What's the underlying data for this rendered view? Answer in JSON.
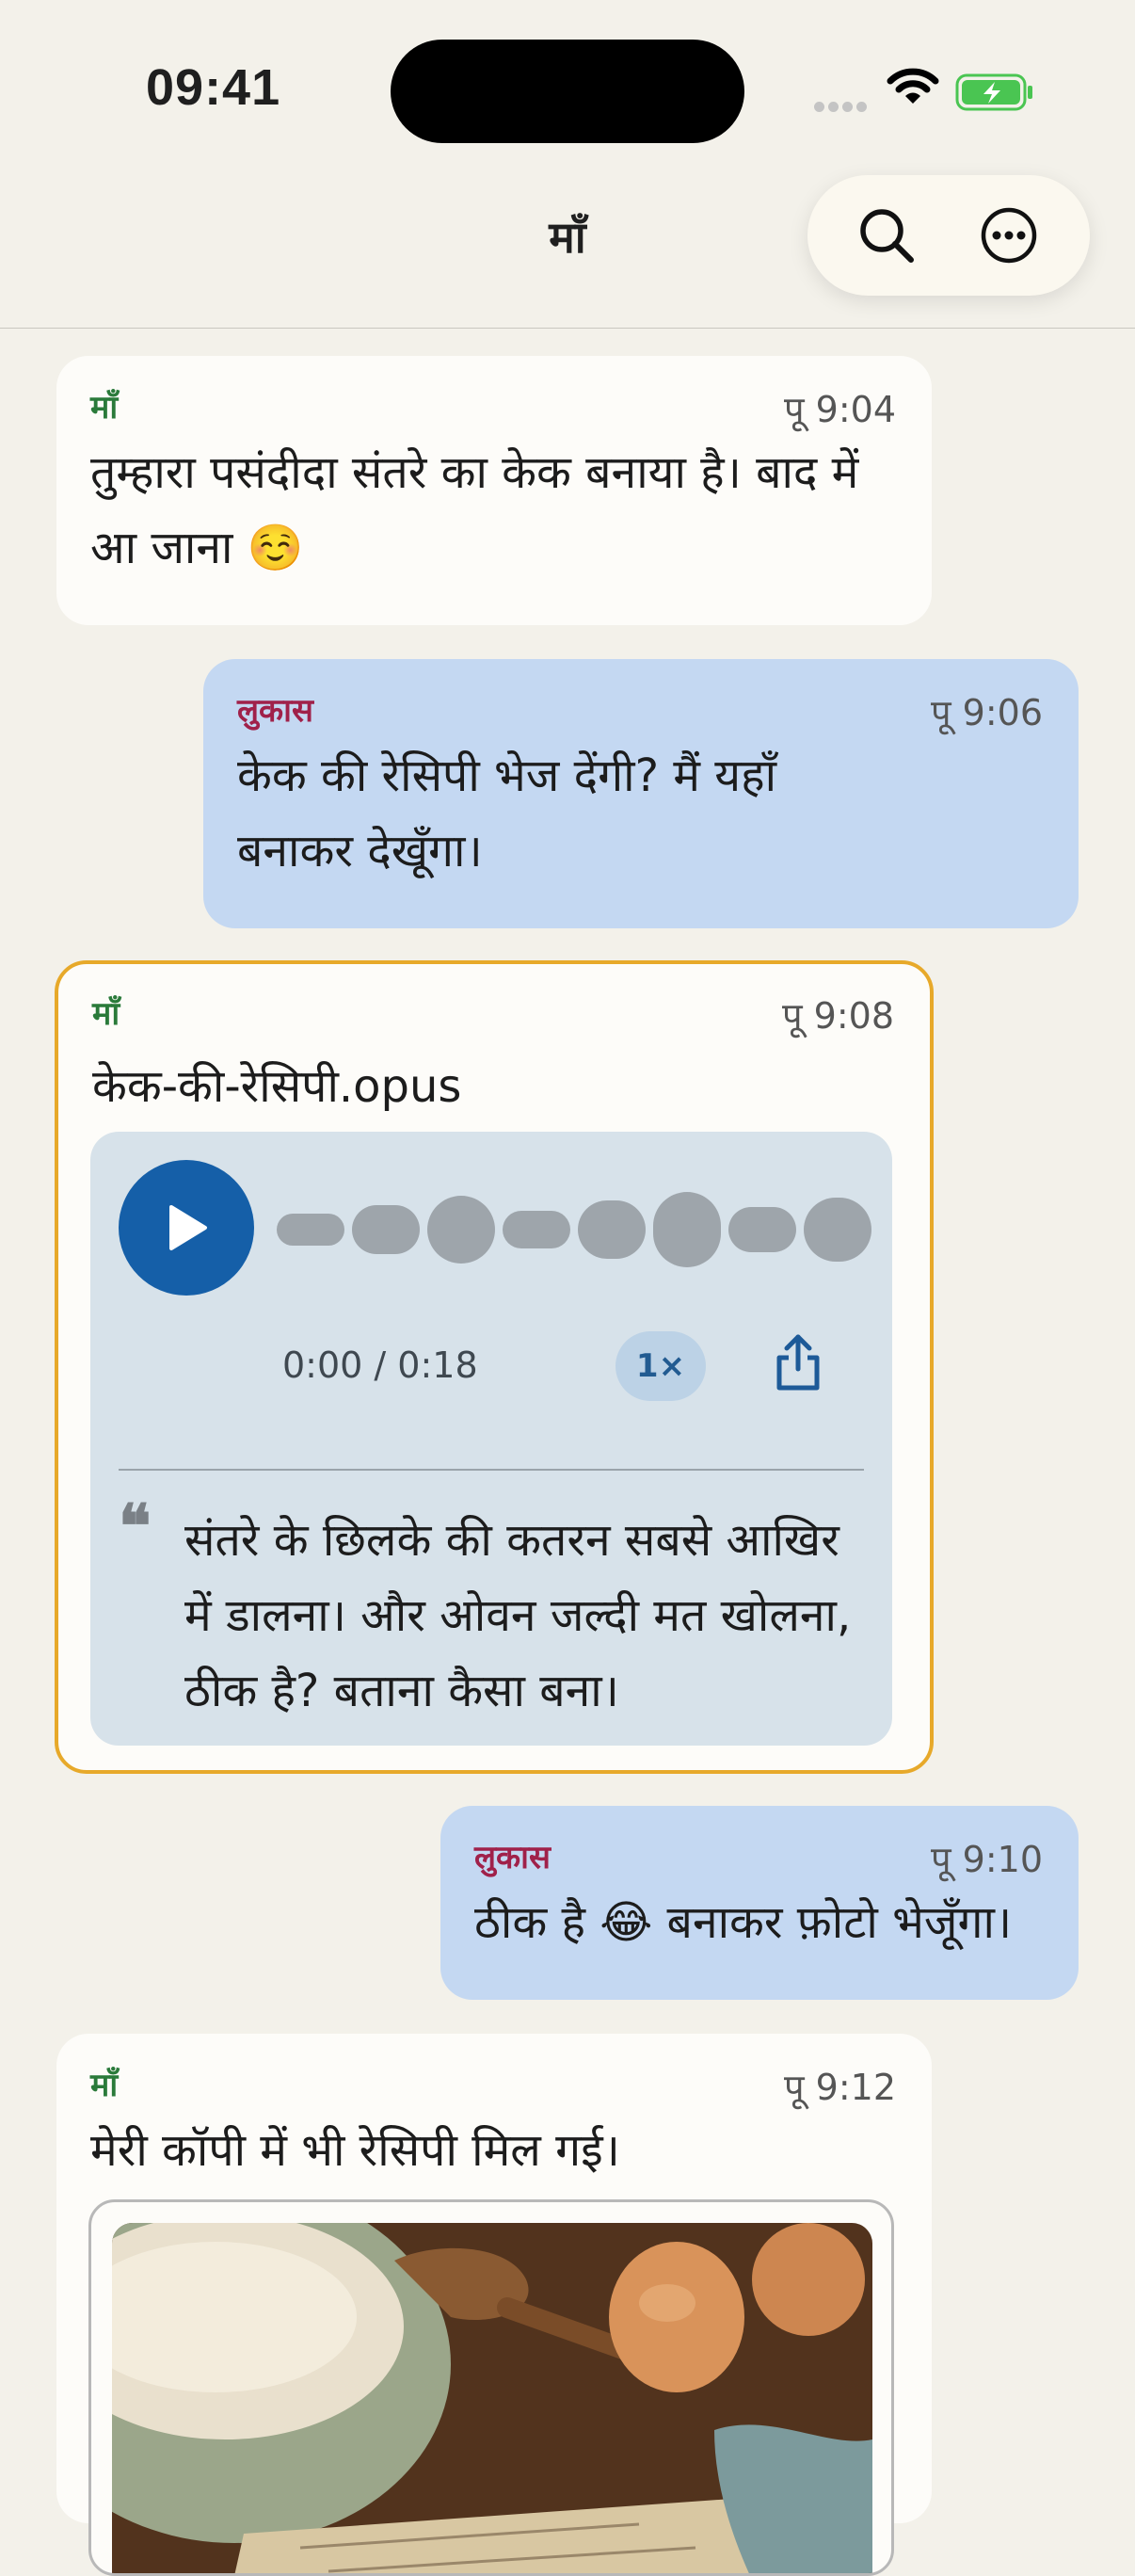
{
  "status": {
    "time": "09:41"
  },
  "header": {
    "title": "माँ"
  },
  "messages": [
    {
      "sender": "माँ",
      "time": "पू 9:04",
      "text": "तुम्हारा पसंदीदा संतरे का केक बनाया है। बाद में आ जाना ☺️"
    },
    {
      "sender": "लुकास",
      "time": "पू 9:06",
      "text": "केक की रेसिपी भेज देंगी? मैं यहाँ बनाकर देखूँगा।"
    },
    {
      "sender": "माँ",
      "time": "पू 9:08",
      "filename": "केक-की-रेसिपी.opus",
      "duration": "0:00 / 0:18",
      "speed": "1×",
      "transcript": "संतरे के छिलके की कतरन सबसे आखिर में डालना। और ओवन जल्दी मत खोलना, ठीक है? बताना कैसा बना।"
    },
    {
      "sender": "लुकास",
      "time": "पू 9:10",
      "text": "ठीक है 😂 बनाकर फ़ोटो भेजूँगा।"
    },
    {
      "sender": "माँ",
      "time": "पू 9:12",
      "text": "मेरी कॉपी में भी रेसिपी मिल गई।"
    }
  ],
  "colors": {
    "incoming": "#fdfcf9",
    "outgoing": "#c4d8f2",
    "accent": "#155fa8",
    "highlight": "#e7a92a"
  },
  "icons": [
    "search-icon",
    "more-icon",
    "play-icon",
    "share-icon",
    "wifi-icon",
    "battery-icon"
  ]
}
